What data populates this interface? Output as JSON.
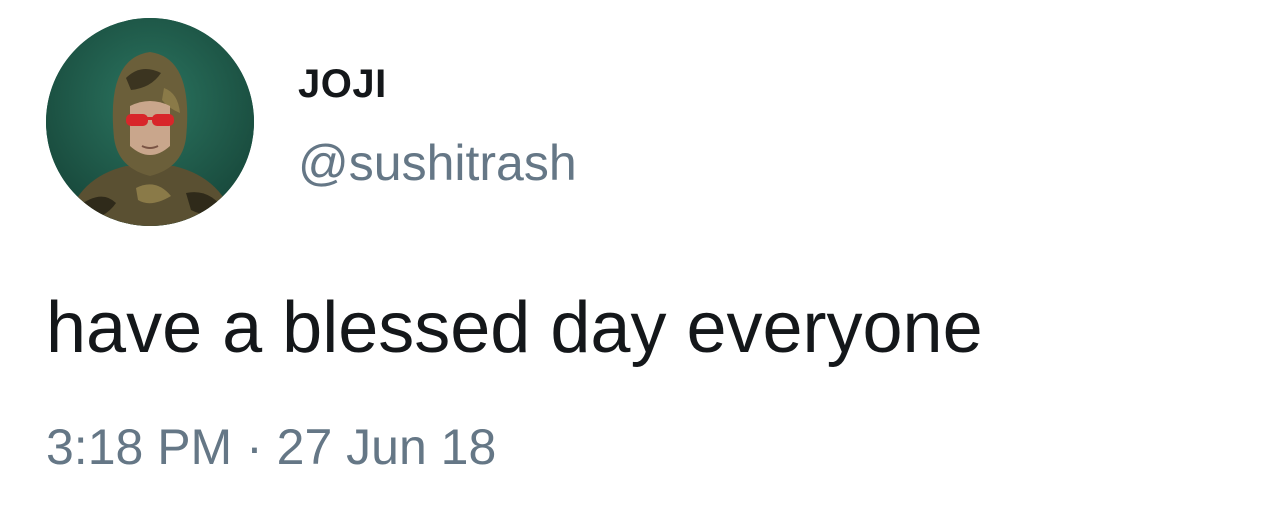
{
  "user": {
    "display_name": "JOJI",
    "handle": "@sushitrash",
    "avatar_icon": "profile-photo-avatar"
  },
  "tweet": {
    "text": "have a blessed day everyone",
    "timestamp": "3:18 PM · 27 Jun 18"
  },
  "colors": {
    "text_primary": "#14171a",
    "text_secondary": "#657786",
    "avatar_background": "#1e5a4a"
  }
}
